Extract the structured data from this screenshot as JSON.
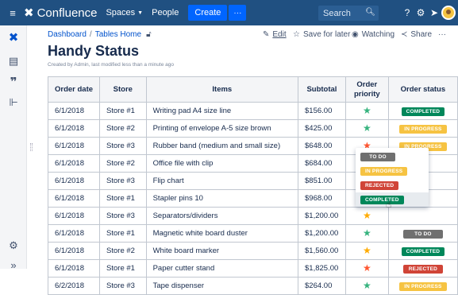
{
  "topnav": {
    "menu_icon": "hamburger-icon",
    "brand": "Confluence",
    "spaces": "Spaces",
    "people": "People",
    "create": "Create",
    "more": "···",
    "search_placeholder": "Search"
  },
  "breadcrumb": {
    "dashboard": "Dashboard",
    "sep": "/",
    "page": "Tables Home"
  },
  "actions": {
    "edit": "Edit",
    "save": "Save for later",
    "watching": "Watching",
    "share": "Share",
    "more": "···"
  },
  "page": {
    "title": "Handy Status",
    "byline": "Created by Admin, last modified less than a minute ago"
  },
  "table": {
    "headers": [
      "Order date",
      "Store",
      "Items",
      "Subtotal",
      "Order priority",
      "Order status"
    ],
    "rows": [
      {
        "date": "6/1/2018",
        "store": "Store #1",
        "item": "Writing pad A4 size line",
        "subtotal": "$156.00",
        "priority": "green",
        "status": "COMPLETED"
      },
      {
        "date": "6/1/2018",
        "store": "Store #2",
        "item": "Printing of envelope A-5 size brown",
        "subtotal": "$425.00",
        "priority": "green",
        "status": "IN PROGRESS"
      },
      {
        "date": "6/1/2018",
        "store": "Store #3",
        "item": "Rubber band (medium and small size)",
        "subtotal": "$648.00",
        "priority": "red",
        "status": "IN PROGRESS"
      },
      {
        "date": "6/1/2018",
        "store": "Store #2",
        "item": "Office file with clip",
        "subtotal": "$684.00",
        "priority": "yellow",
        "status": ""
      },
      {
        "date": "6/1/2018",
        "store": "Store #3",
        "item": "Flip chart",
        "subtotal": "$851.00",
        "priority": "green",
        "status": ""
      },
      {
        "date": "6/1/2018",
        "store": "Store #1",
        "item": "Stapler pins 10",
        "subtotal": "$968.00",
        "priority": "red",
        "status": ""
      },
      {
        "date": "6/1/2018",
        "store": "Store #3",
        "item": "Separators/dividers",
        "subtotal": "$1,200.00",
        "priority": "yellow",
        "status": ""
      },
      {
        "date": "6/1/2018",
        "store": "Store #1",
        "item": "Magnetic white board duster",
        "subtotal": "$1,200.00",
        "priority": "green",
        "status": "TO DO"
      },
      {
        "date": "6/1/2018",
        "store": "Store #2",
        "item": "White board marker",
        "subtotal": "$1,560.00",
        "priority": "yellow",
        "status": "COMPLETED"
      },
      {
        "date": "6/1/2018",
        "store": "Store #1",
        "item": "Paper cutter stand",
        "subtotal": "$1,825.00",
        "priority": "red",
        "status": "REJECTED"
      },
      {
        "date": "6/2/2018",
        "store": "Store #3",
        "item": "Tape dispenser",
        "subtotal": "$264.00",
        "priority": "green",
        "status": "IN PROGRESS"
      }
    ]
  },
  "status_menu": [
    "TO DO",
    "IN PROGRESS",
    "REJECTED",
    "COMPLETED"
  ],
  "colors": {
    "nav": "#205081",
    "COMPLETED": "#00875a",
    "IN PROGRESS": "#f6c342",
    "REJECTED": "#d04437",
    "TO DO": "#707070",
    "green": "#36b37e",
    "red": "#ff5630",
    "yellow": "#ffab00"
  }
}
